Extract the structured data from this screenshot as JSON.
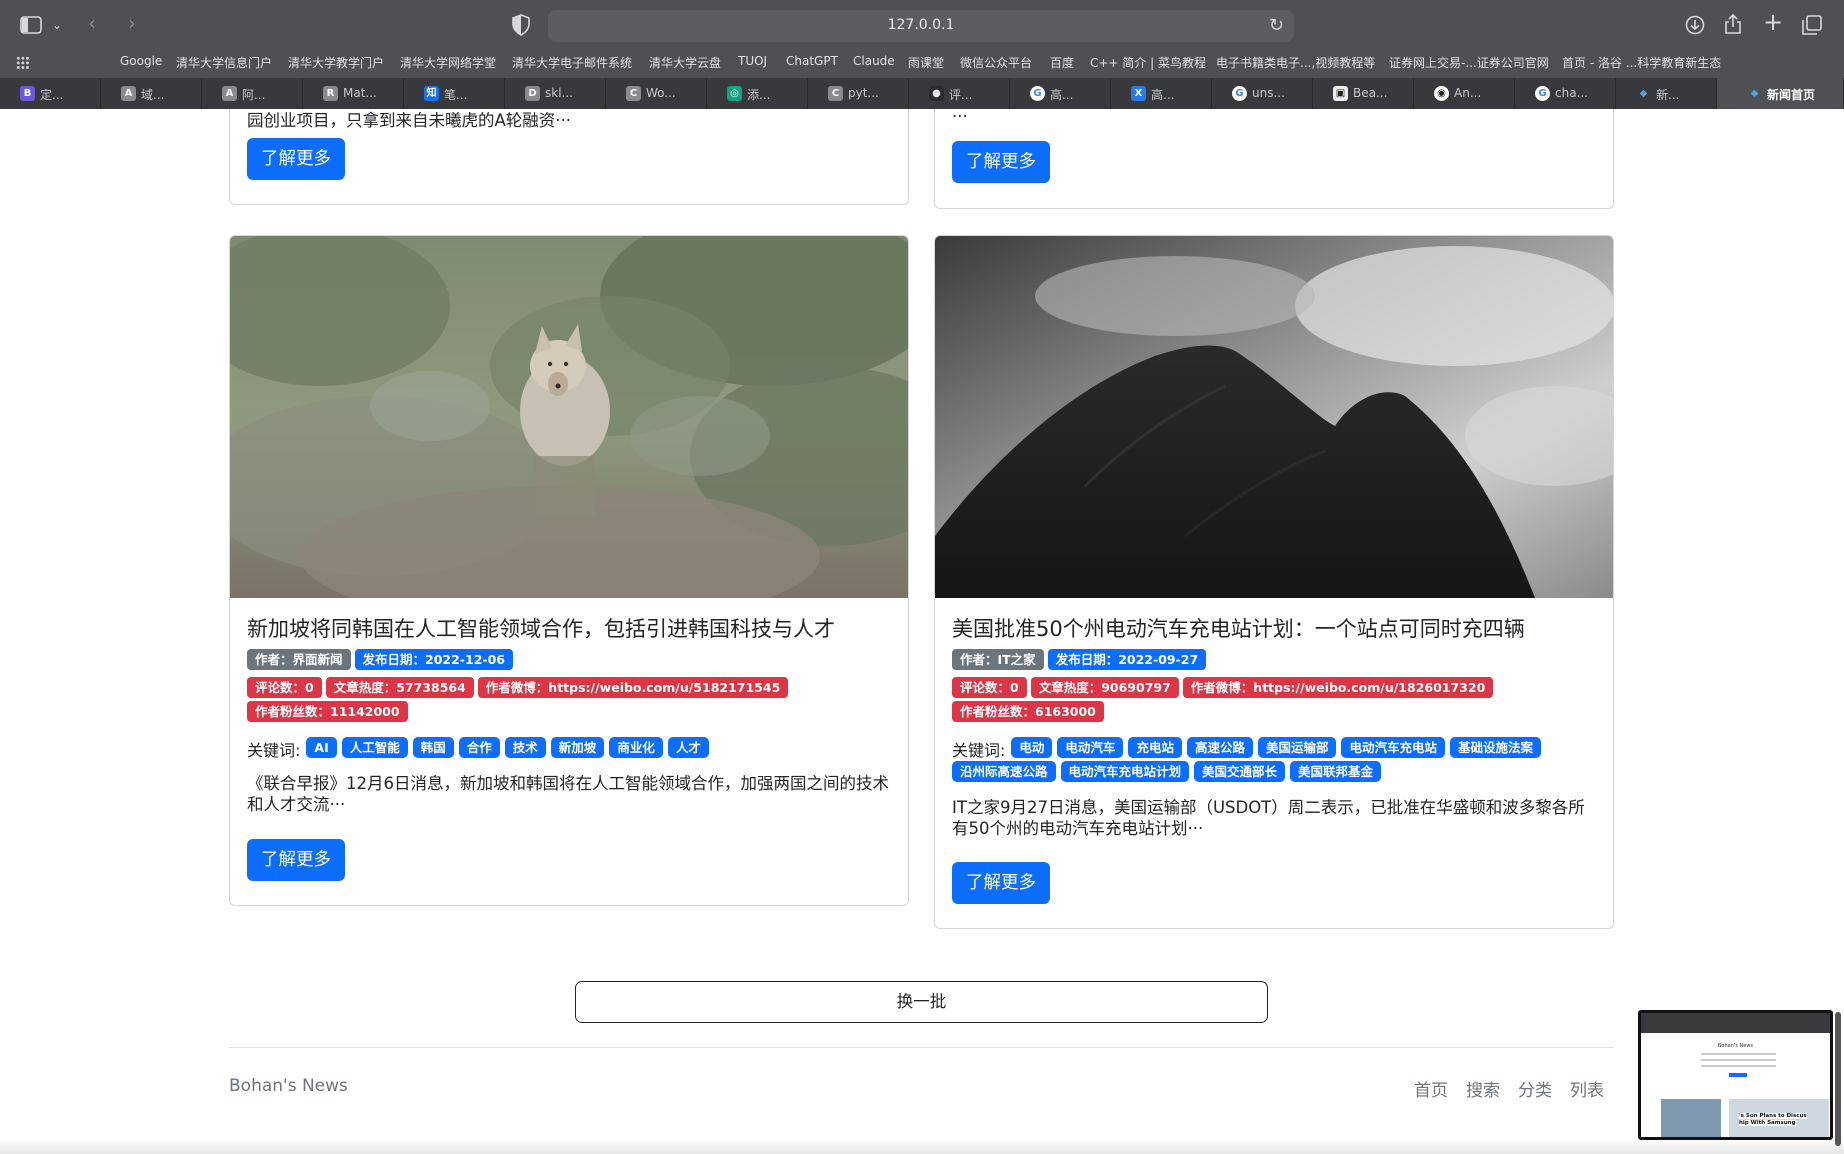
{
  "browser": {
    "url": "127.0.0.1",
    "bookmarks": [
      "Google",
      "清华大学信息门户",
      "清华大学教学门户",
      "清华大学网络学堂",
      "清华大学电子邮件系统",
      "清华大学云盘",
      "TUOJ",
      "ChatGPT",
      "Claude",
      "雨课堂",
      "微信公众平台",
      "百度",
      "C++ 简介 | 菜鸟教程",
      "电子书籍类电子...,视频教程等",
      "证券网上交易-...证券公司官网",
      "首页 - 洛谷 ...科学教育新生态"
    ],
    "tabs": [
      {
        "label": "定...",
        "icon": "B",
        "color": "#6b5bd6"
      },
      {
        "label": "域...",
        "icon": "A",
        "color": "#8a8a8f"
      },
      {
        "label": "阿...",
        "icon": "A",
        "color": "#8a8a8f"
      },
      {
        "label": "Mat...",
        "icon": "R",
        "color": "#8a8a8f"
      },
      {
        "label": "笔...",
        "icon": "知",
        "color": "#1772f6"
      },
      {
        "label": "skl...",
        "icon": "D",
        "color": "#8a8a8f"
      },
      {
        "label": "Wo...",
        "icon": "C",
        "color": "#8a8a8f"
      },
      {
        "label": "添...",
        "icon": "◎",
        "color": "#10a37f"
      },
      {
        "label": "pyt...",
        "icon": "C",
        "color": "#8a8a8f"
      },
      {
        "label": "评...",
        "icon": "●",
        "color": "#2a2b2e"
      },
      {
        "label": "高...",
        "icon": "G",
        "color": "#ffffff"
      },
      {
        "label": "高...",
        "icon": "X",
        "color": "#2a7be4"
      },
      {
        "label": "uns...",
        "icon": "G",
        "color": "#ffffff"
      },
      {
        "label": "Bea...",
        "icon": "▣",
        "color": "#eeeeee"
      },
      {
        "label": "An...",
        "icon": "◉",
        "color": "#ffffff"
      },
      {
        "label": "cha...",
        "icon": "G",
        "color": "#ffffff"
      },
      {
        "label": "新...",
        "icon": "◆",
        "color": "#38393d"
      },
      {
        "label": "新闻首页",
        "icon": "◆",
        "color": "#4f5054"
      }
    ]
  },
  "top_cards": {
    "left_snippet": "园创业项目，只拿到来自未曦虎的A轮融资···",
    "right_snippet": "···",
    "more_label": "了解更多"
  },
  "articles": [
    {
      "title": "新加坡将同韩国在人工智能领域合作，包括引进韩国科技与人才",
      "author": "作者：界面新闻",
      "date": "发布日期：2022-12-06",
      "comments": "评论数：0",
      "heat": "文章热度：57738564",
      "weibo": "作者微博：https://weibo.com/u/5182171545",
      "fans": "作者粉丝数：11142000",
      "keywords_label": "关键词:",
      "keywords": [
        "AI",
        "人工智能",
        "韩国",
        "合作",
        "技术",
        "新加坡",
        "商业化",
        "人才"
      ],
      "summary": "《联合早报》12月6日消息，新加坡和韩国将在人工智能领域合作，加强两国之间的技术和人才交流···",
      "more_label": "了解更多"
    },
    {
      "title": "美国批准50个州电动汽车充电站计划：一个站点可同时充四辆",
      "author": "作者：IT之家",
      "date": "发布日期：2022-09-27",
      "comments": "评论数：0",
      "heat": "文章热度：90690797",
      "weibo": "作者微博：https://weibo.com/u/1826017320",
      "fans": "作者粉丝数：6163000",
      "keywords_label": "关键词:",
      "keywords": [
        "电动",
        "电动汽车",
        "充电站",
        "高速公路",
        "美国运输部",
        "电动汽车充电站",
        "基础设施法案",
        "沿州际高速公路",
        "电动汽车充电站计划",
        "美国交通部长",
        "美国联邦基金"
      ],
      "summary": "IT之家9月27日消息，美国运输部（USDOT）周二表示，已批准在华盛顿和波多黎各所有50个州的电动汽车充电站计划···",
      "more_label": "了解更多"
    }
  ],
  "swap_label": "换一批",
  "footer": {
    "brand": "Bohan's News",
    "nav": [
      "首页",
      "搜索",
      "分类",
      "列表"
    ]
  },
  "thumbnail": {
    "title": "Bohan's News",
    "caption_1": "'s Son Plans to Discus",
    "caption_2": "hip With Samsung"
  }
}
